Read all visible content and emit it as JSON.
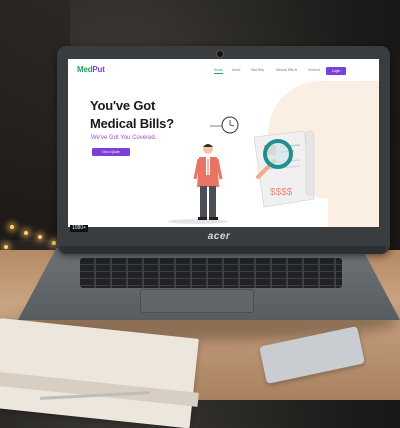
{
  "scene": {
    "brand": "acer",
    "watermark": "1080+"
  },
  "website": {
    "logo": {
      "part1": "Med",
      "part2": "Put"
    },
    "nav": [
      "Home",
      "About",
      "Med Bills",
      "Medical Bills Al",
      "Services"
    ],
    "login_label": "Login",
    "hero": {
      "line1": "You've Got",
      "line2": "Medical Bills?",
      "subtitle": "We've Got You Covered.",
      "cta_label": "Get a Quote"
    },
    "receipt_text": "$$$$"
  },
  "colors": {
    "brand_green": "#1f9e6b",
    "brand_purple": "#7b3fd6",
    "blob": "#fbeee3"
  }
}
